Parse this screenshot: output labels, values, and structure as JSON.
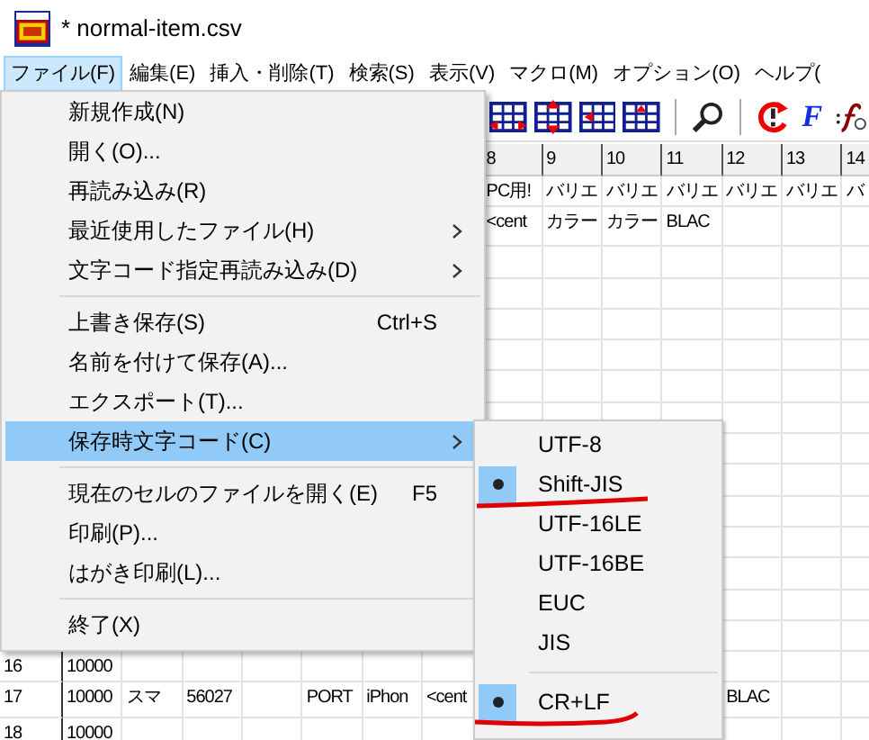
{
  "window": {
    "title": "* normal-item.csv"
  },
  "menu_bar": [
    {
      "label": "ファイル(F)",
      "selected": true
    },
    {
      "label": "編集(E)",
      "selected": false
    },
    {
      "label": "挿入・削除(T)",
      "selected": false
    },
    {
      "label": "検索(S)",
      "selected": false
    },
    {
      "label": "表示(V)",
      "selected": false
    },
    {
      "label": "マクロ(M)",
      "selected": false
    },
    {
      "label": "オプション(O)",
      "selected": false
    },
    {
      "label": "ヘルプ(",
      "selected": false
    }
  ],
  "toolbar": {
    "text_buttons": [
      "F"
    ]
  },
  "grid": {
    "column_headers": [
      "8",
      "9",
      "10",
      "11",
      "12",
      "13",
      "14"
    ],
    "rows": [
      {
        "kind": "normal",
        "cells": [
          null,
          null,
          null,
          null,
          null,
          null,
          null,
          "PC用!",
          "バリエ",
          "バリエ",
          "バリエ",
          "バリエ",
          "バリエ",
          "バ"
        ]
      },
      {
        "kind": "tall",
        "cells": [
          null,
          null,
          null,
          null,
          null,
          null,
          null,
          "<cent",
          "カラー",
          "カラー",
          "BLAC"
        ]
      },
      {
        "kind": "blank"
      },
      {
        "kind": "blank"
      },
      {
        "kind": "blank"
      },
      {
        "kind": "blank"
      },
      {
        "kind": "blank"
      },
      {
        "kind": "blank"
      },
      {
        "kind": "blank"
      },
      {
        "kind": "blank"
      },
      {
        "kind": "blank"
      },
      {
        "kind": "blank"
      },
      {
        "kind": "blank"
      },
      {
        "kind": "blank"
      },
      {
        "kind": "blank"
      },
      {
        "kind": "normal",
        "number": "16",
        "cells": [
          "10000"
        ]
      },
      {
        "kind": "tall",
        "number": "17",
        "cells": [
          "10000",
          "スマ",
          "56027",
          null,
          "PORT",
          "iPhon",
          "<cent",
          null,
          null,
          null,
          null,
          "BLAC"
        ]
      },
      {
        "kind": "normal",
        "number": "18",
        "cells": [
          "10000"
        ]
      }
    ]
  },
  "file_menu": [
    {
      "kind": "item",
      "label": "新規作成(N)",
      "selected": false,
      "submenu": false
    },
    {
      "kind": "item",
      "label": "開く(O)...",
      "selected": false,
      "submenu": false
    },
    {
      "kind": "item",
      "label": "再読み込み(R)",
      "selected": false,
      "submenu": false
    },
    {
      "kind": "item",
      "label": "最近使用したファイル(H)",
      "selected": false,
      "submenu": true
    },
    {
      "kind": "item",
      "label": "文字コード指定再読み込み(D)",
      "selected": false,
      "submenu": true
    },
    {
      "kind": "separator"
    },
    {
      "kind": "item",
      "label": "上書き保存(S)",
      "shortcut": "Ctrl+S",
      "selected": false,
      "submenu": false
    },
    {
      "kind": "item",
      "label": "名前を付けて保存(A)...",
      "selected": false,
      "submenu": false
    },
    {
      "kind": "item",
      "label": "エクスポート(T)...",
      "selected": false,
      "submenu": false
    },
    {
      "kind": "item",
      "label": "保存時文字コード(C)",
      "selected": true,
      "submenu": true
    },
    {
      "kind": "separator"
    },
    {
      "kind": "item",
      "label": "現在のセルのファイルを開く(E)",
      "shortcut": "F5",
      "selected": false,
      "submenu": false
    },
    {
      "kind": "item",
      "label": "印刷(P)...",
      "selected": false,
      "submenu": false
    },
    {
      "kind": "item",
      "label": "はがき印刷(L)...",
      "selected": false,
      "submenu": false
    },
    {
      "kind": "separator"
    },
    {
      "kind": "item",
      "label": "終了(X)",
      "selected": false,
      "submenu": false
    }
  ],
  "encoding_submenu": [
    {
      "kind": "item",
      "label": "UTF-8",
      "checked": false
    },
    {
      "kind": "item",
      "label": "Shift-JIS",
      "checked": true
    },
    {
      "kind": "item",
      "label": "UTF-16LE",
      "checked": false
    },
    {
      "kind": "item",
      "label": "UTF-16BE",
      "checked": false
    },
    {
      "kind": "item",
      "label": "EUC",
      "checked": false
    },
    {
      "kind": "item",
      "label": "JIS",
      "checked": false
    },
    {
      "kind": "separator"
    },
    {
      "kind": "item",
      "label": "CR+LF",
      "checked": true
    }
  ]
}
